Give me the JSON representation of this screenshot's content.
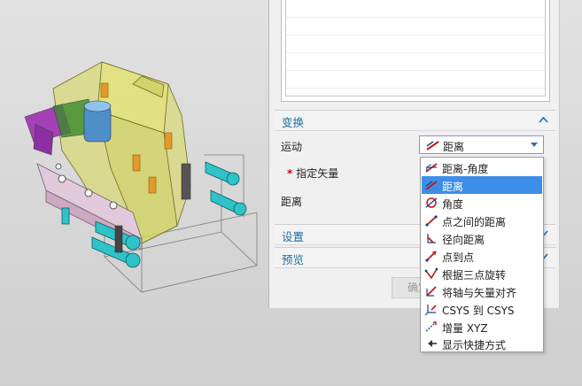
{
  "panel": {
    "transform_section": {
      "title": "变换"
    },
    "motion_label": "运动",
    "motion_value": "距离",
    "vector_label": "指定矢量",
    "distance_label": "距离",
    "settings_section": {
      "title": "设置"
    },
    "preview_section": {
      "title": "预览"
    },
    "ok_button": "确定"
  },
  "dropdown": {
    "selected_index": 1,
    "items": [
      {
        "label": "距离-角度",
        "icon": "distance-angle-icon"
      },
      {
        "label": "距离",
        "icon": "distance-icon"
      },
      {
        "label": "角度",
        "icon": "angle-icon"
      },
      {
        "label": "点之间的距离",
        "icon": "point-distance-icon"
      },
      {
        "label": "径向距离",
        "icon": "radial-distance-icon"
      },
      {
        "label": "点到点",
        "icon": "point-to-point-icon"
      },
      {
        "label": "根据三点旋转",
        "icon": "three-point-rotate-icon"
      },
      {
        "label": "将轴与矢量对齐",
        "icon": "align-axis-icon"
      },
      {
        "label": "CSYS 到 CSYS",
        "icon": "csys-icon"
      },
      {
        "label": "增量 XYZ",
        "icon": "delta-xyz-icon"
      },
      {
        "label": "显示快捷方式",
        "icon": "shortcut-icon"
      }
    ]
  },
  "colors": {
    "section_title": "#1d6fa5",
    "selection": "#3d8ee8",
    "required_mark": "#d40000"
  }
}
